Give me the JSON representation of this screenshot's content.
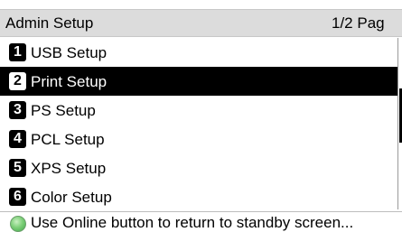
{
  "header": {
    "title": "Admin Setup",
    "page_indicator": "1/2 Pag"
  },
  "menu": {
    "items": [
      {
        "number": "1",
        "label": "USB Setup"
      },
      {
        "number": "2",
        "label": "Print Setup"
      },
      {
        "number": "3",
        "label": "PS Setup"
      },
      {
        "number": "4",
        "label": "PCL Setup"
      },
      {
        "number": "5",
        "label": "XPS Setup"
      },
      {
        "number": "6",
        "label": "Color Setup"
      }
    ],
    "selected": "Print Setup"
  },
  "footer": {
    "hint": "Use Online button to return to standby screen..."
  },
  "colors": {
    "selected_bg": "#000000",
    "title_bg": "#dcdcdc",
    "online_led": "#6fcf6f"
  }
}
